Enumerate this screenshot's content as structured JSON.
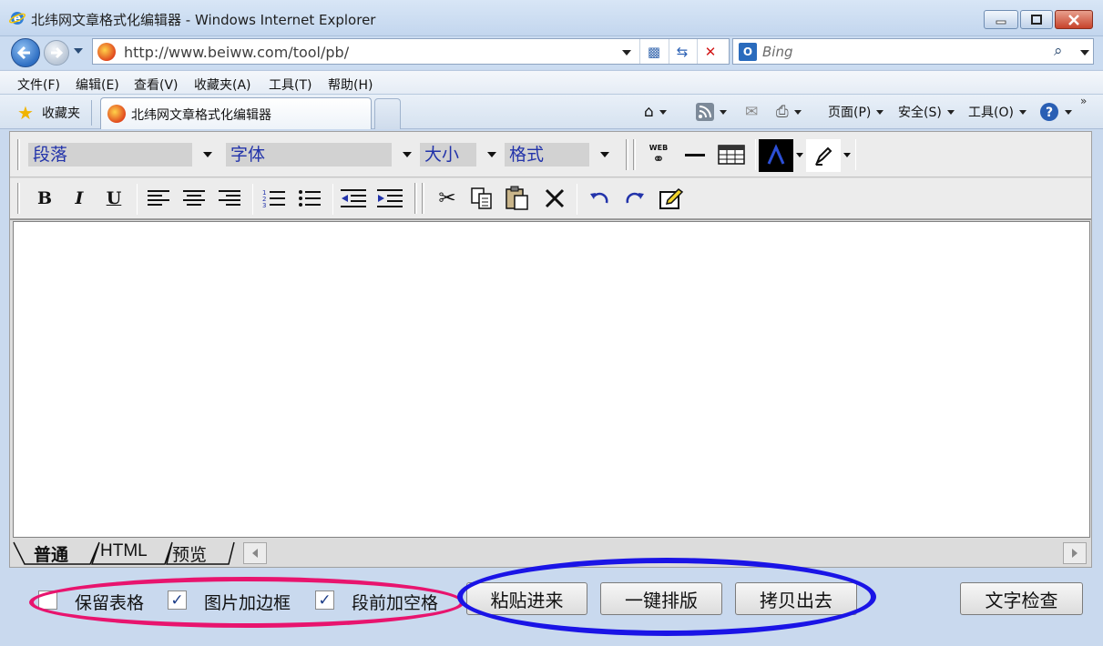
{
  "window": {
    "title": "北纬网文章格式化编辑器 - Windows Internet Explorer"
  },
  "address_bar": {
    "url": "http://www.beiww.com/tool/pb/",
    "search_placeholder": "Bing"
  },
  "menu": {
    "items": [
      "文件(F)",
      "编辑(E)",
      "查看(V)",
      "收藏夹(A)",
      "工具(T)",
      "帮助(H)"
    ]
  },
  "favorites_bar": {
    "favorites_label": "收藏夹",
    "tab_title": "北纬网文章格式化编辑器",
    "commands": [
      "页面(P)",
      "安全(S)",
      "工具(O)"
    ]
  },
  "editor": {
    "toolbar": {
      "paragraph": "段落",
      "font": "字体",
      "size": "大小",
      "format": "格式",
      "web_link_label": "WEB"
    },
    "mode_tabs": [
      "普通",
      "HTML",
      "预览"
    ]
  },
  "options": {
    "keep_tables": {
      "label": "保留表格",
      "checked": false
    },
    "image_border": {
      "label": "图片加边框",
      "checked": true
    },
    "paragraph_indent": {
      "label": "段前加空格",
      "checked": true
    }
  },
  "buttons": {
    "paste_in": "粘贴进来",
    "one_click_format": "一键排版",
    "copy_out": "拷贝出去",
    "spell_check": "文字检查"
  },
  "colors": {
    "highlight_options": "#e8146e",
    "highlight_buttons": "#1a14e6"
  }
}
